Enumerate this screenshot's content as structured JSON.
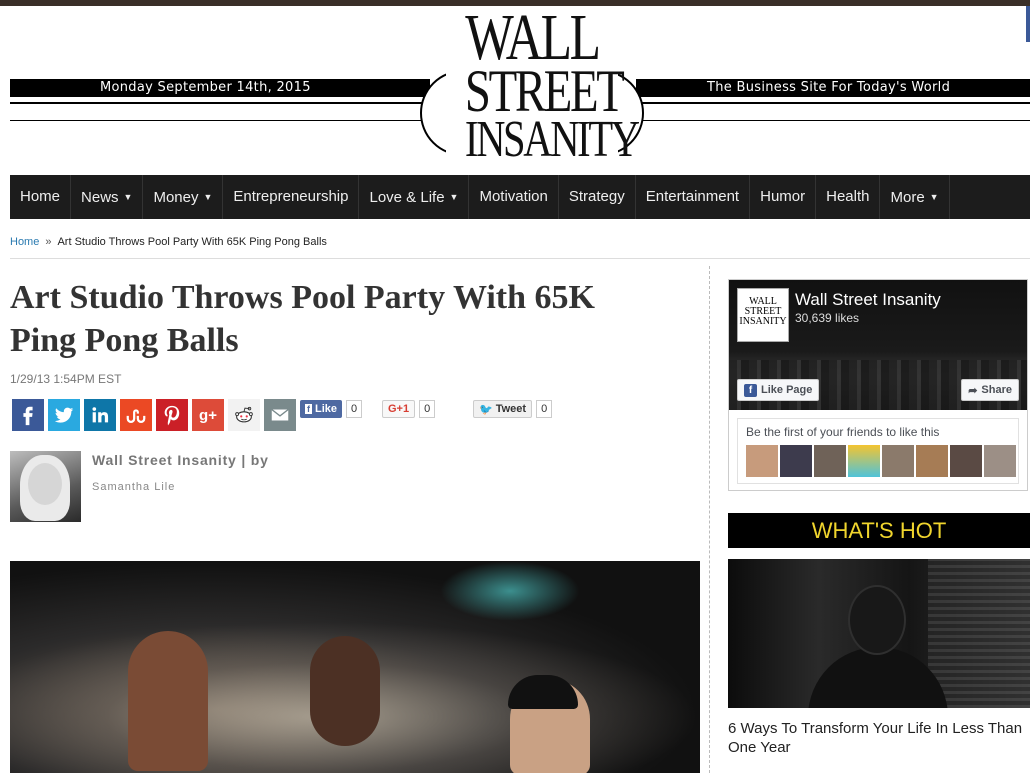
{
  "header": {
    "date": "Monday September 14th, 2015",
    "tagline": "The Business Site For Today's World",
    "logo_line1": "WALL",
    "logo_line2": "STREET",
    "logo_line3": "INSANITY"
  },
  "nav": {
    "items": [
      {
        "label": "Home",
        "dropdown": false
      },
      {
        "label": "News",
        "dropdown": true
      },
      {
        "label": "Money",
        "dropdown": true
      },
      {
        "label": "Entrepreneurship",
        "dropdown": false
      },
      {
        "label": "Love & Life",
        "dropdown": true
      },
      {
        "label": "Motivation",
        "dropdown": false
      },
      {
        "label": "Strategy",
        "dropdown": false
      },
      {
        "label": "Entertainment",
        "dropdown": false
      },
      {
        "label": "Humor",
        "dropdown": false
      },
      {
        "label": "Health",
        "dropdown": false
      },
      {
        "label": "More",
        "dropdown": true
      }
    ]
  },
  "breadcrumb": {
    "home": "Home",
    "separator": "»",
    "current": "Art Studio Throws Pool Party With 65K Ping Pong Balls"
  },
  "article": {
    "title": "Art Studio Throws Pool Party With 65K Ping Pong Balls",
    "date": "1/29/13 1:54PM EST",
    "byline": "Wall Street Insanity | by",
    "author": "Samantha Lile"
  },
  "share": {
    "icons": [
      "facebook-icon",
      "twitter-icon",
      "linkedin-icon",
      "stumbleupon-icon",
      "pinterest-icon",
      "googleplus-icon",
      "reddit-icon",
      "email-icon"
    ],
    "fb_like_label": "Like",
    "fb_like_count": "0",
    "gplus_label": "G+1",
    "gplus_count": "0",
    "tweet_label": "Tweet",
    "tweet_count": "0"
  },
  "sidebar": {
    "fb_page_name": "Wall Street Insanity",
    "fb_likes": "30,639 likes",
    "fb_like_page": "Like Page",
    "fb_share": "Share",
    "fb_friends_text": "Be the first of your friends to like this",
    "whats_hot": "WHAT'S HOT",
    "hot_article": "6 Ways To Transform Your Life In Less Than One Year"
  },
  "colors": {
    "facebook": "#3b5998",
    "twitter": "#2aa9e0",
    "linkedin": "#0e76a8",
    "stumbleupon": "#eb4924",
    "pinterest": "#cb2027",
    "googleplus": "#dd4b39",
    "whats_hot_text": "#f0d52d",
    "nav_bg": "#1c1c1c"
  }
}
